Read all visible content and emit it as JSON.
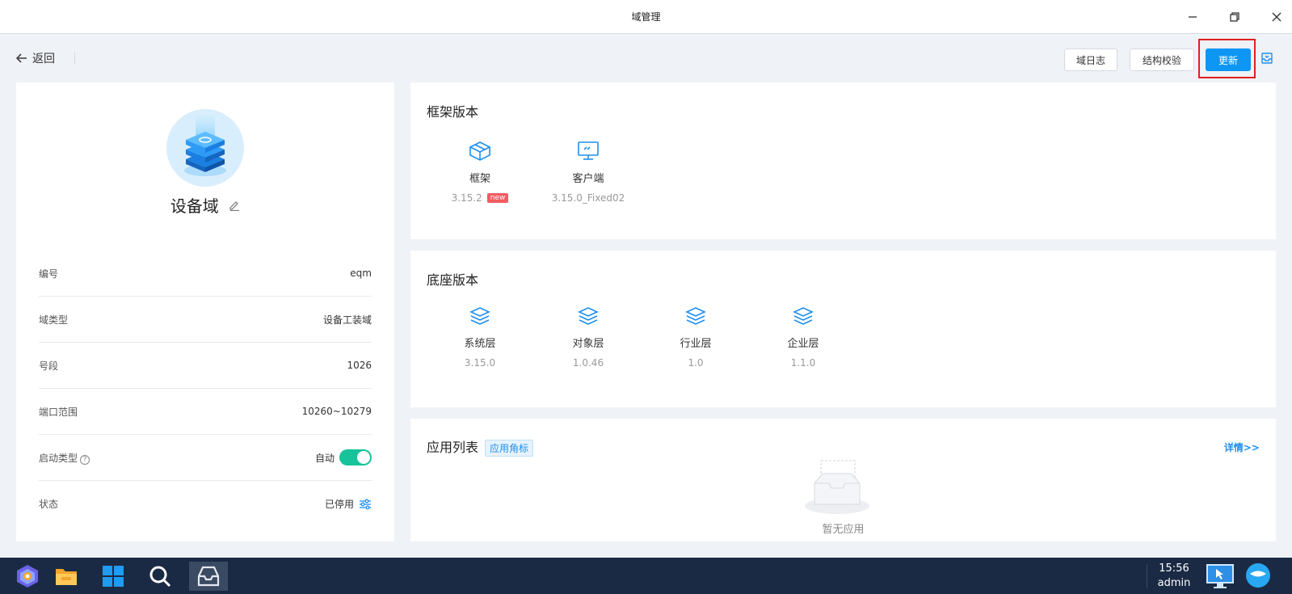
{
  "window": {
    "title": "域管理"
  },
  "toolbar": {
    "back_label": "返回",
    "log_button": "域日志",
    "check_button": "结构校验",
    "update_button": "更新"
  },
  "domain": {
    "name": "设备域",
    "info": [
      {
        "label": "编号",
        "value": "eqm"
      },
      {
        "label": "域类型",
        "value": "设备工装域"
      },
      {
        "label": "号段",
        "value": "1026"
      },
      {
        "label": "端口范围",
        "value": "10260~10279"
      },
      {
        "label": "启动类型",
        "value": "自动",
        "toggle_on": true
      },
      {
        "label": "状态",
        "value": "已停用"
      }
    ]
  },
  "framework": {
    "title": "框架版本",
    "items": [
      {
        "name": "框架",
        "version": "3.15.2",
        "badge": "new",
        "icon": "cube-icon"
      },
      {
        "name": "客户端",
        "version": "3.15.0_Fixed02",
        "icon": "monitor-icon"
      }
    ]
  },
  "base": {
    "title": "底座版本",
    "items": [
      {
        "name": "系统层",
        "version": "3.15.0",
        "icon": "layers-icon"
      },
      {
        "name": "对象层",
        "version": "1.0.46",
        "icon": "layers-icon"
      },
      {
        "name": "行业层",
        "version": "1.0",
        "icon": "layers-icon"
      },
      {
        "name": "企业层",
        "version": "1.1.0",
        "icon": "layers-icon"
      }
    ]
  },
  "apps": {
    "title": "应用列表",
    "tag": "应用角标",
    "detail_link": "详情>>",
    "empty_text": "暂无应用"
  },
  "taskbar": {
    "time": "15:56",
    "user": "admin"
  },
  "colors": {
    "primary": "#0d96f3",
    "toggle_on": "#16c39a",
    "badge_new": "#f25c62",
    "highlight": "#e0201f",
    "taskbar_bg": "#1b2a44"
  }
}
